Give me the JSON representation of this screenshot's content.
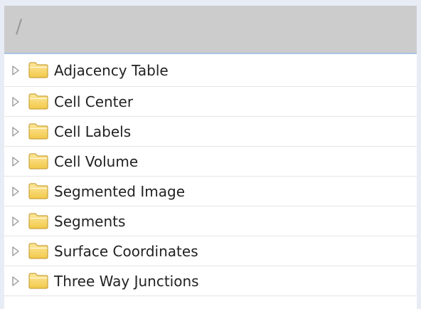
{
  "path": "/",
  "items": [
    {
      "label": "Adjacency Table",
      "icon": "folder-icon"
    },
    {
      "label": "Cell Center",
      "icon": "folder-icon"
    },
    {
      "label": "Cell Labels",
      "icon": "folder-icon"
    },
    {
      "label": "Cell Volume",
      "icon": "folder-icon"
    },
    {
      "label": "Segmented Image",
      "icon": "folder-icon"
    },
    {
      "label": "Segments",
      "icon": "folder-icon"
    },
    {
      "label": "Surface Coordinates",
      "icon": "folder-icon"
    },
    {
      "label": "Three Way Junctions",
      "icon": "folder-icon"
    }
  ],
  "colors": {
    "background": "#e8edf5",
    "header": "#cccccc",
    "header_border": "#aac2e2",
    "folder_fill": "#f7d96b",
    "folder_stroke": "#c9a23a",
    "expander": "#9a9a9a"
  }
}
